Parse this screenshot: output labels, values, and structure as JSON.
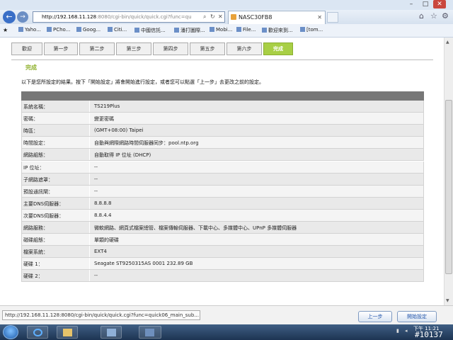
{
  "browser": {
    "address_host": "http://192.168.11.128",
    "address_rest": ":8080/cgi-bin/quick/quick.cgi?func=qu",
    "tab_title": "NASC30FB8",
    "favorites": [
      {
        "label": "Yaho..."
      },
      {
        "label": "PCho..."
      },
      {
        "label": "Goog..."
      },
      {
        "label": "Citi..."
      },
      {
        "label": "中國信託..."
      },
      {
        "label": "潘打圖際..."
      },
      {
        "label": "Mobi..."
      },
      {
        "label": "File..."
      },
      {
        "label": "歡迎來到..."
      },
      {
        "label": "[tom..."
      }
    ]
  },
  "wizard": {
    "steps": [
      {
        "label": "歡迎"
      },
      {
        "label": "第一步"
      },
      {
        "label": "第二步"
      },
      {
        "label": "第三步"
      },
      {
        "label": "第四步"
      },
      {
        "label": "第五步"
      },
      {
        "label": "第六步"
      },
      {
        "label": "完成"
      }
    ],
    "active_step": "完成",
    "heading": "完成",
    "intro": "以下是您所設定的結果。按下「開始設定」將會開始進行設定，或者您可以點選「上一步」去更改之前的設定。",
    "rows": [
      {
        "key": "系統名稱：",
        "value": "TS219Plus"
      },
      {
        "key": "密碼：",
        "value": "變更密碼"
      },
      {
        "key": "時區：",
        "value": "(GMT+08:00) Taipei"
      },
      {
        "key": "時間設定：",
        "value": "自動與網際網路時間伺服器同步：pool.ntp.org"
      },
      {
        "key": "網路組態：",
        "value": "自動取得 IP 位址 (DHCP)"
      },
      {
        "key": "IP 位址：",
        "value": "--"
      },
      {
        "key": "子網路遮罩：",
        "value": "--"
      },
      {
        "key": "預設通訊閘：",
        "value": "--"
      },
      {
        "key": "主要DNS伺服器：",
        "value": "8.8.8.8"
      },
      {
        "key": "次要DNS伺服器：",
        "value": "8.8.4.4"
      },
      {
        "key": "網路服務：",
        "value": "微軟網路、網頁式檔案總管、檔案傳輸伺服器、下載中心、多媒體中心、UPnP 多媒體伺服器"
      },
      {
        "key": "磁碟組態：",
        "value": "單顆的硬碟"
      },
      {
        "key": "檔案系統：",
        "value": "EXT4"
      },
      {
        "key": "硬碟 1：",
        "value": "Seagate ST9250315AS 0001 232.89 GB"
      },
      {
        "key": "硬碟 2：",
        "value": "--"
      }
    ],
    "back_label": "上一步",
    "start_label": "開始設定"
  },
  "statusbar": {
    "tip": "http://192.168.11.128:8080/cgi-bin/quick/quick.cgi?func=quick06_main_sub..."
  },
  "taskbar": {
    "clock_line1": "下午 11:21",
    "watermark": "#10137"
  },
  "colors": {
    "accent_green": "#a8cf45",
    "heading_green": "#8fb12d",
    "table_header": "#777777"
  }
}
